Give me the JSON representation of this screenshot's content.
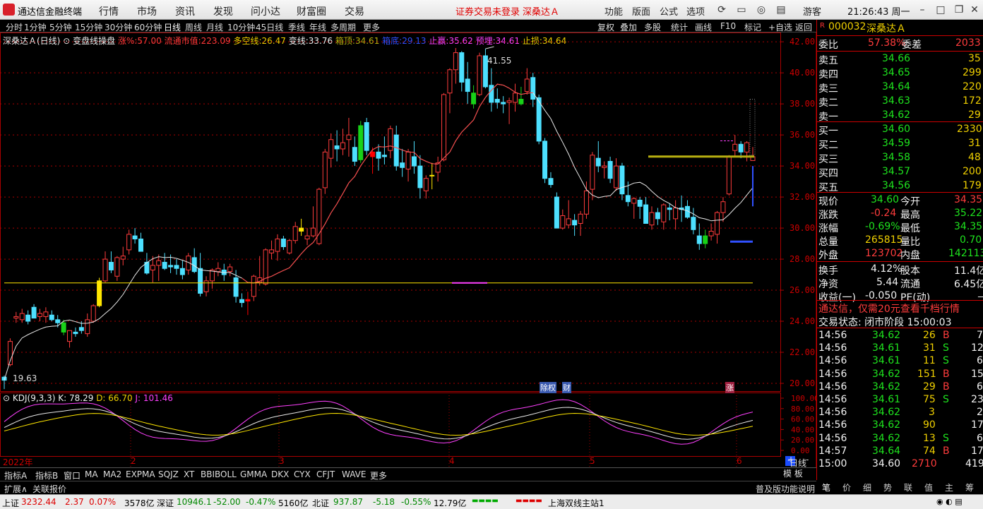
{
  "titlebar": {
    "app": "通达信金融终端",
    "menus": [
      "行情",
      "市场",
      "资讯",
      "发现",
      "问小达",
      "财富圈",
      "交易"
    ],
    "warning": "证券交易未登录",
    "stock_link": "深桑达Ａ",
    "right_menus": [
      "功能",
      "版面",
      "公式",
      "选项"
    ],
    "user": "游客",
    "time": "21:26:43 周一"
  },
  "toolbar": {
    "periods": [
      "分时",
      "1分钟",
      "5分钟",
      "15分钟",
      "30分钟",
      "60分钟",
      "日线",
      "周线",
      "月线",
      "10分钟",
      "45日线",
      "季线",
      "年线",
      "多周期",
      "更多"
    ],
    "active": "日线",
    "tools": [
      "复权",
      "叠加",
      "多股",
      "统计",
      "画线",
      "F10",
      "标记",
      "+自选",
      "返回"
    ]
  },
  "chart_info": {
    "name": "深桑达Ａ(日线)",
    "indicator": "变盘线操盘",
    "rise_label": "涨%:",
    "rise_val": "57.00",
    "cap_label": "流通市值:",
    "cap_val": "223.09",
    "ls_label": "多空线:",
    "ls_val": "26.47",
    "bl_label": "变线:",
    "bl_val": "33.76",
    "top_label": "箱顶:",
    "top_val": "34.61",
    "bot_label": "箱底:",
    "bot_val": "29.13",
    "sp_label": "止赢:",
    "sp_val": "35.62",
    "pre_label": "预埋:",
    "pre_val": "34.61",
    "sl_label": "止损:",
    "sl_val": "34.64"
  },
  "chart_data": {
    "type": "candlestick",
    "ylim": [
      19.5,
      42.6
    ],
    "y_ticks": [
      "42.00",
      "40.00",
      "38.00",
      "36.00",
      "34.00",
      "32.00",
      "30.00",
      "28.00",
      "26.00",
      "24.00",
      "22.00",
      "20.00"
    ],
    "high_marker": "41.55",
    "low_marker": "19.63",
    "x_labels": [
      "2022年",
      "2",
      "3",
      "4",
      "5",
      "6"
    ],
    "events": [
      "除权",
      "财",
      "涨"
    ],
    "kdj": {
      "label": "KDJ(9,3,3)",
      "k": "K: 78.29",
      "d": "D: 66.70",
      "j": "J: 101.46",
      "ticks": [
        "100.00",
        "80.00",
        "60.00",
        "40.00",
        "20.00",
        "0.00"
      ]
    }
  },
  "panel": {
    "code": "000032",
    "name": "深桑达Ａ",
    "weibi_label": "委比",
    "weibi": "57.38%",
    "weicha_label": "委差",
    "weicha": "2033",
    "asks": [
      [
        "卖五",
        "34.66",
        "35"
      ],
      [
        "卖四",
        "34.65",
        "299"
      ],
      [
        "卖三",
        "34.64",
        "220"
      ],
      [
        "卖二",
        "34.63",
        "172"
      ],
      [
        "卖一",
        "34.62",
        "29"
      ]
    ],
    "bids": [
      [
        "买一",
        "34.60",
        "2330"
      ],
      [
        "买二",
        "34.59",
        "31"
      ],
      [
        "买三",
        "34.58",
        "48"
      ],
      [
        "买四",
        "34.57",
        "200"
      ],
      [
        "买五",
        "34.56",
        "179"
      ]
    ],
    "stats": [
      [
        "现价",
        "34.60",
        "今开",
        "34.35"
      ],
      [
        "涨跌",
        "-0.24",
        "最高",
        "35.22"
      ],
      [
        "涨幅",
        "-0.69%",
        "最低",
        "34.35"
      ],
      [
        "总量",
        "265815",
        "量比",
        "0.70"
      ],
      [
        "外盘",
        "123702",
        "内盘",
        "142113"
      ]
    ],
    "stats2": [
      [
        "换手",
        "4.12%",
        "股本",
        "11.4亿"
      ],
      [
        "净资",
        "5.44",
        "流通",
        "6.45亿"
      ],
      [
        "收益(一)",
        "-0.050",
        "PE(动)",
        "－"
      ]
    ],
    "ad": "通达信，仅需20元查看千档行情",
    "state": "交易状态: 闭市阶段 15:00:03",
    "ticks": [
      [
        "14:56",
        "34.62",
        "26",
        "B",
        "7"
      ],
      [
        "14:56",
        "34.61",
        "31",
        "S",
        "12"
      ],
      [
        "14:56",
        "34.61",
        "11",
        "S",
        "6"
      ],
      [
        "14:56",
        "34.62",
        "151",
        "B",
        "15"
      ],
      [
        "14:56",
        "34.62",
        "29",
        "B",
        "6"
      ],
      [
        "14:56",
        "34.61",
        "75",
        "S",
        "23"
      ],
      [
        "14:56",
        "34.62",
        "3",
        "",
        "2"
      ],
      [
        "14:56",
        "34.62",
        "90",
        "",
        "17"
      ],
      [
        "14:56",
        "34.62",
        "13",
        "S",
        "6"
      ],
      [
        "14:57",
        "34.64",
        "74",
        "B",
        "17"
      ],
      [
        "15:00",
        "34.60",
        "2710",
        "",
        "419"
      ]
    ],
    "btabs": [
      "笔",
      "价",
      "细",
      "势",
      "联",
      "值",
      "主",
      "筹"
    ],
    "model": "模 板",
    "plus": "+",
    "minus": "-",
    "zoom_minus": "--",
    "day": "日线"
  },
  "bottom_tabs": [
    "指标A",
    "指标B",
    "窗口",
    "MA",
    "MA2",
    "EXPMA",
    "SQJZ",
    "XT",
    "BBIBOLL",
    "GMMA",
    "DKX",
    "CYX",
    "CFJT",
    "WAVE",
    "更多"
  ],
  "ext": {
    "a": "扩展∧",
    "b": "关联报价",
    "c": "普及版功能说明"
  },
  "status": {
    "sh_label": "上证",
    "sh": "3232.44",
    "sh_chg": "2.37",
    "sh_pct": "0.07%",
    "sh_amt": "3578亿",
    "sz_label": "深证",
    "sz": "10946.1",
    "sz_chg": "-52.00",
    "sz_pct": "-0.47%",
    "sz_amt": "5160亿",
    "bz_label": "北证",
    "bz": "937.87",
    "bz_chg": "-5.18",
    "bz_pct": "-0.55%",
    "bz_amt": "12.79亿",
    "server": "上海双线主站1"
  }
}
